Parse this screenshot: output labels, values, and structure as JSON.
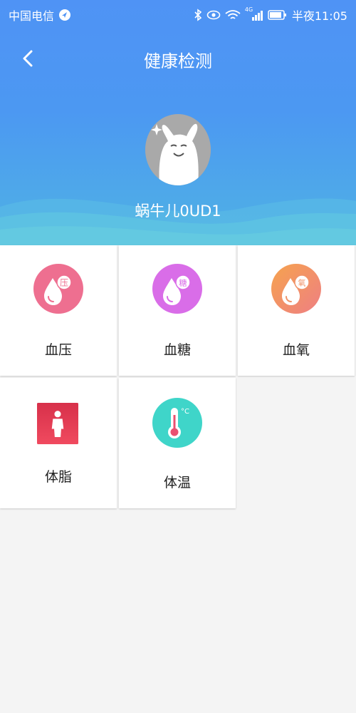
{
  "status_bar": {
    "carrier": "中国电信",
    "time": "半夜11:05",
    "network": "4G"
  },
  "header": {
    "title": "健康检测",
    "username": "蜗牛儿0UD1"
  },
  "items": [
    {
      "label": "血压",
      "badge": "压",
      "icon": "blood-pressure-icon",
      "color": "#ee6f90"
    },
    {
      "label": "血糖",
      "badge": "糖",
      "icon": "blood-sugar-icon",
      "color": "#d96de8"
    },
    {
      "label": "血氧",
      "badge": "氧",
      "icon": "blood-oxygen-icon",
      "color": "#f0946a"
    },
    {
      "label": "体脂",
      "icon": "body-fat-icon",
      "color": "#e0384f"
    },
    {
      "label": "体温",
      "badge": "°C",
      "icon": "thermometer-icon",
      "color": "#3fd5c9"
    }
  ],
  "colors": {
    "header_top": "#4f93f5",
    "header_bottom": "#4fb2e4",
    "background": "#f4f4f4"
  }
}
